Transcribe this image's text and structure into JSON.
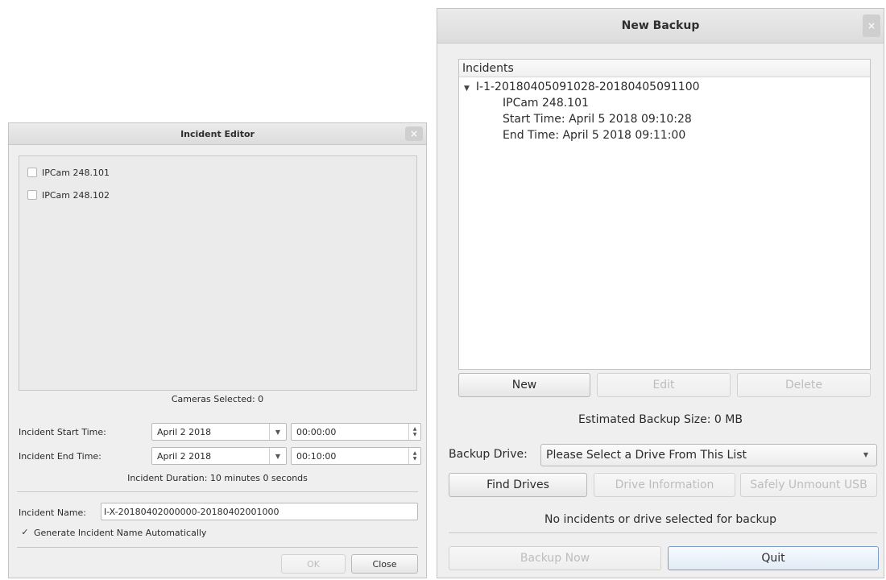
{
  "incident_editor": {
    "title": "Incident Editor",
    "close_icon": "×",
    "cameras": [
      {
        "label": "IPCam 248.101",
        "checked": false
      },
      {
        "label": "IPCam 248.102",
        "checked": false
      }
    ],
    "cameras_selected": "Cameras Selected: 0",
    "start_label": "Incident Start Time:",
    "start_date": "April 2 2018",
    "start_time": "00:00:00",
    "end_label": "Incident End Time:",
    "end_date": "April 2 2018",
    "end_time": "00:10:00",
    "duration": "Incident Duration: 10 minutes 0 seconds",
    "name_label": "Incident Name:",
    "name_value": "I-X-20180402000000-20180402001000",
    "auto_name_check": "✓",
    "auto_name_label": "Generate Incident Name Automatically",
    "ok_label": "OK",
    "close_label": "Close"
  },
  "new_backup": {
    "title": "New Backup",
    "close_icon": "×",
    "tree_header": "Incidents",
    "incident": {
      "expand_icon": "▼",
      "name": "I-1-20180405091028-20180405091100",
      "camera": "IPCam 248.101",
      "start": "Start Time: April 5 2018 09:10:28",
      "end": "End Time: April 5 2018 09:11:00"
    },
    "new_label": "New",
    "edit_label": "Edit",
    "delete_label": "Delete",
    "estimated_size": "Estimated Backup Size: 0 MB",
    "drive_label": "Backup Drive:",
    "drive_value": "Please Select a Drive From This List",
    "find_drives_label": "Find Drives",
    "drive_info_label": "Drive Information",
    "unmount_label": "Safely Unmount USB",
    "status": "No incidents or drive selected for backup",
    "backup_now_label": "Backup Now",
    "quit_label": "Quit"
  },
  "icons": {
    "dropdown": "▼",
    "spin_up": "▲",
    "spin_down": "▼"
  }
}
